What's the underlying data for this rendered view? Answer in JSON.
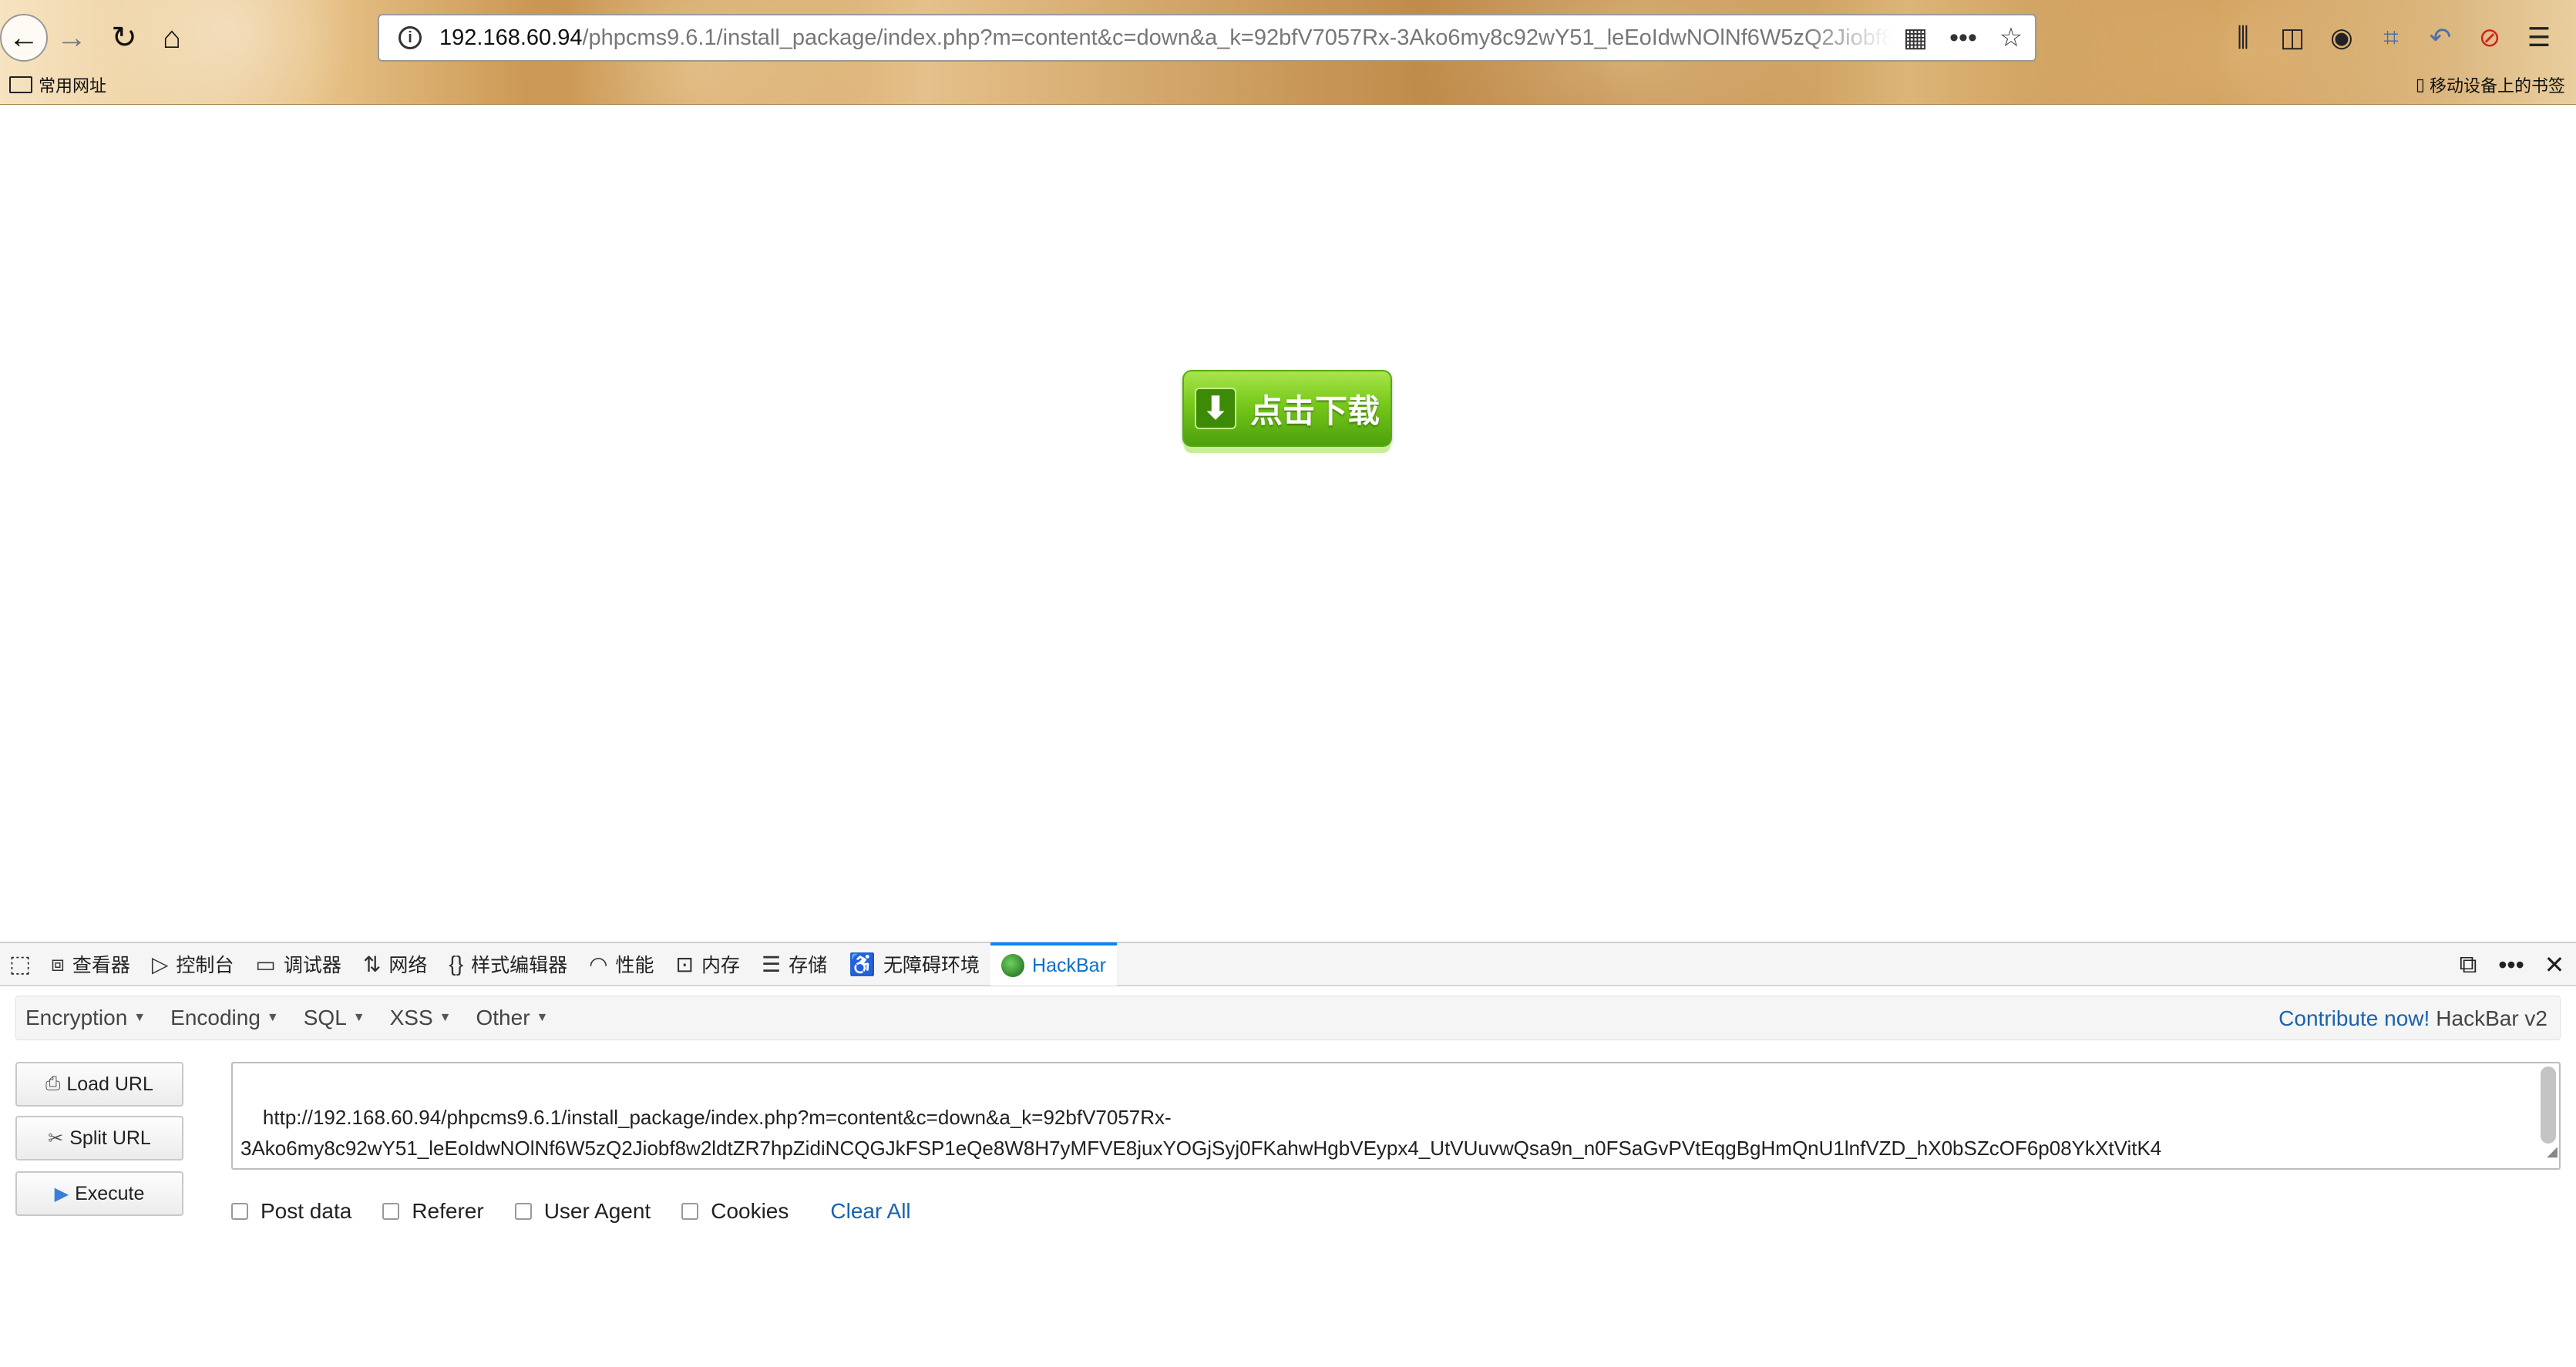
{
  "browser": {
    "url_host": "192.168.60.94",
    "url_path": "/phpcms9.6.1/install_package/index.php?m=content&c=down&a_k=92bfV7057Rx-3Ako6my8c92wY51_leEoIdwNOlNf6W5zQ2Jiobf8w2ldtZR7hpZidiNCQGJkFSP1eQe8W8H7yMFVE8juxYOGjSyj0FKahwHgbVEypx4_UtVUuvwQsa9n_n0FSaGvPVtEqgBgHmQnU1lnfVZD_hX0bSZcOF6p08YkXtVitK4",
    "bookmarks": {
      "folder_label": "常用网址",
      "mobile_label": "移动设备上的书签"
    }
  },
  "page": {
    "download_button_label": "点击下载"
  },
  "devtools": {
    "tabs": [
      {
        "label": "查看器",
        "icon": "inspector-icon"
      },
      {
        "label": "控制台",
        "icon": "console-icon"
      },
      {
        "label": "调试器",
        "icon": "debugger-icon"
      },
      {
        "label": "网络",
        "icon": "network-icon"
      },
      {
        "label": "样式编辑器",
        "icon": "style-editor-icon"
      },
      {
        "label": "性能",
        "icon": "performance-icon"
      },
      {
        "label": "内存",
        "icon": "memory-icon"
      },
      {
        "label": "存储",
        "icon": "storage-icon"
      },
      {
        "label": "无障碍环境",
        "icon": "accessibility-icon"
      },
      {
        "label": "HackBar",
        "icon": "hackbar-icon",
        "active": true
      }
    ]
  },
  "hackbar": {
    "menu": [
      "Encryption",
      "Encoding",
      "SQL",
      "XSS",
      "Other"
    ],
    "contribute_label": "Contribute now!",
    "version_label": "HackBar v2",
    "buttons": {
      "load": "Load URL",
      "split": "Split URL",
      "execute": "Execute"
    },
    "url_value": "http://192.168.60.94/phpcms9.6.1/install_package/index.php?m=content&c=down&a_k=92bfV7057Rx-\n3Ako6my8c92wY51_leEoIdwNOlNf6W5zQ2Jiobf8w2ldtZR7hpZidiNCQGJkFSP1eQe8W8H7yMFVE8juxYOGjSyj0FKahwHgbVEypx4_UtVUuvwQsa9n_n0FSaGvPVtEqgBgHmQnU1lnfVZD_hX0bSZcOF6p08YkXtVitK4",
    "options": {
      "post_data": "Post data",
      "referer": "Referer",
      "user_agent": "User Agent",
      "cookies": "Cookies",
      "clear_all": "Clear All"
    }
  }
}
